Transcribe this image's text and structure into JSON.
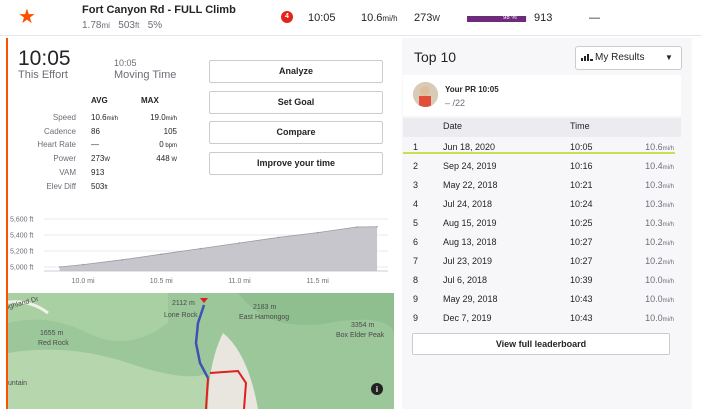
{
  "segment": {
    "name": "Fort Canyon Rd - FULL Climb",
    "distance": "1.78",
    "distance_unit": "mi",
    "elevation": "503",
    "elevation_unit": "ft",
    "grade": "5%",
    "rank_badge": "4",
    "effort_time": "10:05",
    "speed": "10.6",
    "speed_unit": "mi/h",
    "power": "273",
    "power_unit": "W",
    "heart_rate_pct_label": "98 %",
    "heart_rate_pct": 98,
    "vam": "913",
    "extra": "—",
    "colors": {
      "accent": "#fc5200",
      "hr_bar": "#6d2b7a",
      "badge": "#e1251b"
    }
  },
  "effort": {
    "time": "10:05",
    "time_label": "This Effort",
    "moving_time": "10:05",
    "moving_time_label": "Moving Time",
    "table": {
      "headers": {
        "avg": "AVG",
        "max": "MAX"
      },
      "rows": [
        {
          "label": "Speed",
          "avg": "10.6",
          "avg_unit": "mi/h",
          "max": "19.0",
          "max_unit": "mi/h"
        },
        {
          "label": "Cadence",
          "avg": "86",
          "avg_unit": "",
          "max": "105",
          "max_unit": ""
        },
        {
          "label": "Heart Rate",
          "avg": "—",
          "avg_unit": "",
          "max": "0",
          "max_unit": " bpm"
        },
        {
          "label": "Power",
          "avg": "273",
          "avg_unit": "W",
          "max": "448",
          "max_unit": " W"
        },
        {
          "label": "VAM",
          "avg": "913",
          "avg_unit": "",
          "max": "",
          "max_unit": ""
        },
        {
          "label": "Elev Diff",
          "avg": "503",
          "avg_unit": "ft",
          "max": "",
          "max_unit": ""
        }
      ]
    }
  },
  "actions": {
    "analyze": "Analyze",
    "set_goal": "Set Goal",
    "compare": "Compare",
    "improve": "Improve your time"
  },
  "chart_data": {
    "type": "area",
    "x": [
      9.85,
      10.0,
      10.25,
      10.5,
      10.75,
      11.0,
      11.25,
      11.5,
      11.75,
      11.88
    ],
    "values": [
      5000,
      5030,
      5090,
      5160,
      5230,
      5300,
      5370,
      5430,
      5500,
      5503
    ],
    "x_ticks": [
      "10.0 mi",
      "10.5 mi",
      "11.0 mi",
      "11.5 mi"
    ],
    "y_ticks": [
      "5,600 ft",
      "5,400 ft",
      "5,200 ft",
      "5,000 ft"
    ],
    "xlim": [
      9.75,
      11.95
    ],
    "ylim": [
      4950,
      5650
    ],
    "grid": true
  },
  "map": {
    "labels": [
      {
        "text": "2112 m"
      },
      {
        "text": "Lone Rock"
      },
      {
        "text": "2183 m"
      },
      {
        "text": "East Hamongog"
      },
      {
        "text": "3354 m"
      },
      {
        "text": "Box Elder Peak"
      },
      {
        "text": "1655 m"
      },
      {
        "text": "Red Rock"
      },
      {
        "text": "ighland Dr"
      },
      {
        "text": "untain"
      }
    ],
    "info_icon": "info-icon"
  },
  "leaderboard": {
    "title": "Top 10",
    "filter": "My Results",
    "pr": {
      "title": "Your PR 10:05",
      "rank": "– /22"
    },
    "headers": {
      "date": "Date",
      "time": "Time"
    },
    "rows": [
      {
        "rank": "1",
        "date": "Jun 18, 2020",
        "time": "10:05",
        "speed": "10.6",
        "unit": "mi/h"
      },
      {
        "rank": "2",
        "date": "Sep 24, 2019",
        "time": "10:16",
        "speed": "10.4",
        "unit": "mi/h"
      },
      {
        "rank": "3",
        "date": "May 22, 2018",
        "time": "10:21",
        "speed": "10.3",
        "unit": "mi/h"
      },
      {
        "rank": "4",
        "date": "Jul 24, 2018",
        "time": "10:24",
        "speed": "10.3",
        "unit": "mi/h"
      },
      {
        "rank": "5",
        "date": "Aug 15, 2019",
        "time": "10:25",
        "speed": "10.3",
        "unit": "mi/h"
      },
      {
        "rank": "6",
        "date": "Aug 13, 2018",
        "time": "10:27",
        "speed": "10.2",
        "unit": "mi/h"
      },
      {
        "rank": "7",
        "date": "Jul 23, 2019",
        "time": "10:27",
        "speed": "10.2",
        "unit": "mi/h"
      },
      {
        "rank": "8",
        "date": "Jul 6, 2018",
        "time": "10:39",
        "speed": "10.0",
        "unit": "mi/h"
      },
      {
        "rank": "9",
        "date": "May 29, 2018",
        "time": "10:43",
        "speed": "10.0",
        "unit": "mi/h"
      },
      {
        "rank": "9",
        "date": "Dec 7, 2019",
        "time": "10:43",
        "speed": "10.0",
        "unit": "mi/h"
      }
    ],
    "view_full": "View full leaderboard"
  }
}
